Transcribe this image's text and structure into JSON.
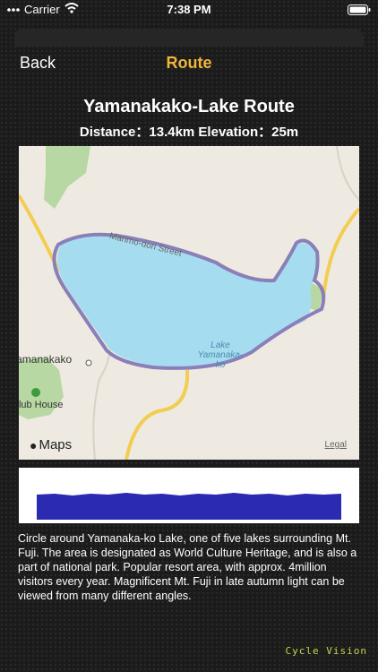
{
  "status": {
    "carrier": "Carrier",
    "time": "7:38 PM"
  },
  "nav": {
    "back_label": "Back",
    "title": "Route"
  },
  "route": {
    "name": "Yamanakako-Lake Route",
    "stats": "Distance：13.4km   Elevation：25m"
  },
  "map": {
    "street_label": "Marimo-dori Street",
    "lake_label_1": "Lake",
    "lake_label_2": "Yamanaka-",
    "lake_label_3": "ko",
    "town_label": "Yamanakako",
    "club_label": "Club House",
    "maps_brand": "Maps",
    "legal_label": "Legal",
    "colors": {
      "lake": "#a6dcef",
      "route": "#8a7fb8",
      "road": "#f2cd52",
      "park": "#b7d8a2"
    }
  },
  "description": "Circle around Yamanaka-ko Lake, one of five lakes surrounding Mt. Fuji. The area is designated as World Culture Heritage, and is also a part of national park.  Popular resort area, with approx. 4million visitors every year. Magnificent Mt. Fuji in late autumn light can be viewed from many different angles.",
  "footer": "Cycle Vision"
}
